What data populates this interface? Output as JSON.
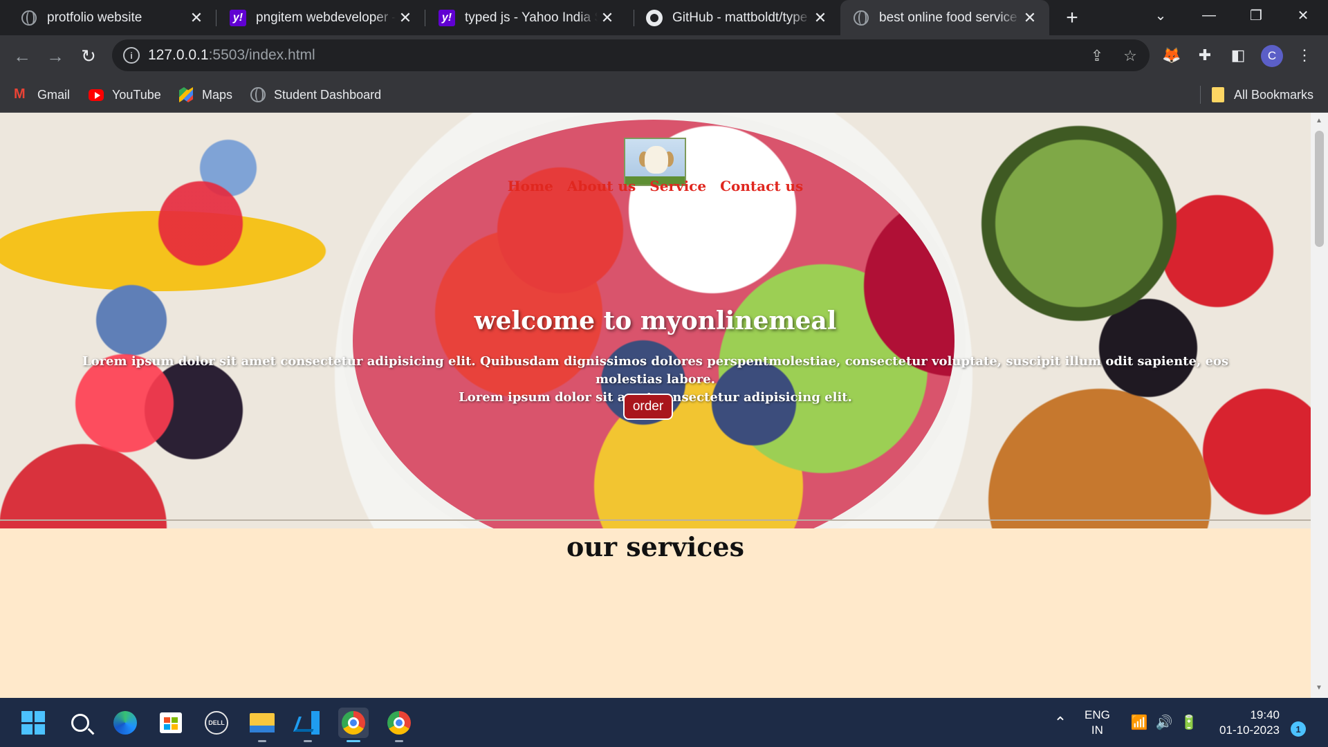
{
  "browser": {
    "tabs": [
      {
        "title": "protfolio website",
        "favicon": "globe-icon"
      },
      {
        "title": "pngitem webdeveloper -",
        "favicon": "yahoo-icon"
      },
      {
        "title": "typed js - Yahoo India Se",
        "favicon": "yahoo-icon"
      },
      {
        "title": "GitHub - mattboldt/type",
        "favicon": "github-icon"
      },
      {
        "title": "best online food service i",
        "favicon": "globe-icon",
        "active": true
      }
    ],
    "yahoo_glyph": "y!",
    "address": {
      "host": "127.0.0.1",
      "rest": ":5503/index.html"
    },
    "profile_initial": "C",
    "bookmarks": [
      {
        "label": "Gmail",
        "icon": "gmail-icon"
      },
      {
        "label": "YouTube",
        "icon": "youtube-icon"
      },
      {
        "label": "Maps",
        "icon": "maps-icon"
      },
      {
        "label": "Student Dashboard",
        "icon": "globe-icon"
      }
    ],
    "all_bookmarks": "All Bookmarks"
  },
  "page": {
    "nav": [
      "Home",
      "About us",
      "Service",
      "Contact us"
    ],
    "welcome": "welcome to myonlinemeal",
    "lorem_1": "Lorem ipsum dolor sit amet consectetur adipisicing elit. Quibusdam dignissimos dolores perspentmolestiae, consectetur voluptate, suscipit illum odit sapiente, eos molestias labore.",
    "lorem_2": "Lorem ipsum dolor sit amet consectetur adipisicing elit.",
    "order_label": "order",
    "services_title": "our services",
    "colors": {
      "nav": "#e0271f",
      "button": "#a9161c",
      "page_bg": "#ffe9cb"
    }
  },
  "taskbar": {
    "apps": [
      "start-icon",
      "search-icon",
      "edge-icon",
      "store-icon",
      "dell-icon",
      "file-explorer-icon",
      "vscode-icon",
      "chrome-icon",
      "chrome-icon"
    ],
    "dell_label": "DELL",
    "lang_1": "ENG",
    "lang_2": "IN",
    "time": "19:40",
    "date": "01-10-2023",
    "notification_count": "1"
  }
}
